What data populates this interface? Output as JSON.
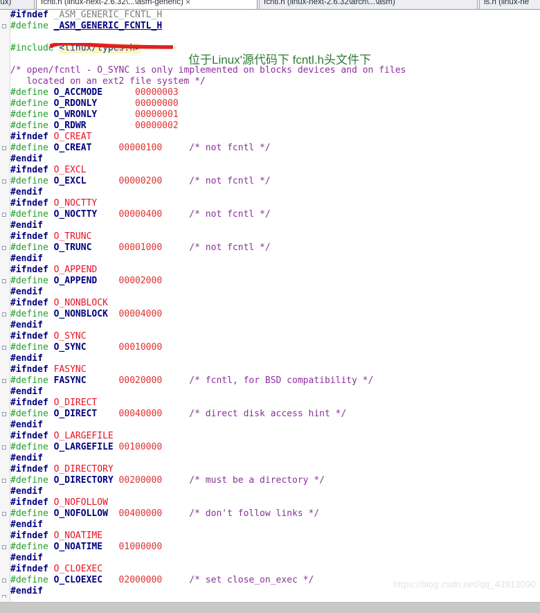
{
  "window": {
    "app": "source-code-editor",
    "tabs": [
      {
        "label": "(linux)",
        "active": false,
        "closable": false
      },
      {
        "label": "fcntl.h (linux-next-2.6.32\\...\\asm-generic)",
        "active": true,
        "closable": true
      },
      {
        "label": "fcntl.h (linux-next-2.6.32\\arch\\...\\asm)",
        "active": false,
        "closable": false
      },
      {
        "label": "ls.h (linux-ne",
        "active": false,
        "closable": false
      }
    ]
  },
  "annotations": {
    "chinese_note": "位于Linux'源代码下 fcntl.h头文件下",
    "chinese_note_color": "#2f7a34",
    "red_underline_color": "#e02020",
    "red_underline_target": "_ASM_GENERIC_FCNTL_H"
  },
  "watermark": {
    "text": "https://blog.csdn.net/qq_43913090"
  },
  "colors": {
    "preprocessor_conditional": "#000080",
    "define_keyword": "#1f9b28",
    "macro_name": "#000080",
    "ifndef_arg": "#e81123",
    "number": "#e03030",
    "comment": "#8a2f9a",
    "header_highlight_bg": "#fdf6b8",
    "header_text": "#1030c0",
    "editor_bg": "#ffffff",
    "gutter_bg": "#f6f6f6",
    "scrollbar_bg": "#c8c8c8"
  },
  "code": {
    "filename": "fcntl.h",
    "guard": "_ASM_GENERIC_FCNTL_H",
    "include": "<linux/types.h>",
    "header_comment": [
      "/* open/fcntl - O_SYNC is only implemented on blocks devices and on files",
      "   located on an ext2 file system */"
    ],
    "plain_defines": [
      {
        "name": "O_ACCMODE",
        "value": "00000003"
      },
      {
        "name": "O_RDONLY",
        "value": "00000000"
      },
      {
        "name": "O_WRONLY",
        "value": "00000001"
      },
      {
        "name": "O_RDWR",
        "value": "00000002"
      }
    ],
    "guarded_defines": [
      {
        "name": "O_CREAT",
        "value": "00000100",
        "comment": "/* not fcntl */"
      },
      {
        "name": "O_EXCL",
        "value": "00000200",
        "comment": "/* not fcntl */"
      },
      {
        "name": "O_NOCTTY",
        "value": "00000400",
        "comment": "/* not fcntl */"
      },
      {
        "name": "O_TRUNC",
        "value": "00001000",
        "comment": "/* not fcntl */"
      },
      {
        "name": "O_APPEND",
        "value": "00002000",
        "comment": ""
      },
      {
        "name": "O_NONBLOCK",
        "value": "00004000",
        "comment": ""
      },
      {
        "name": "O_SYNC",
        "value": "00010000",
        "comment": ""
      },
      {
        "name": "FASYNC",
        "value": "00020000",
        "comment": "/* fcntl, for BSD compatibility */"
      },
      {
        "name": "O_DIRECT",
        "value": "00040000",
        "comment": "/* direct disk access hint */"
      },
      {
        "name": "O_LARGEFILE",
        "value": "00100000",
        "comment": ""
      },
      {
        "name": "O_DIRECTORY",
        "value": "00200000",
        "comment": "/* must be a directory */"
      },
      {
        "name": "O_NOFOLLOW",
        "value": "00400000",
        "comment": "/* don't follow links */"
      },
      {
        "name": "O_NOATIME",
        "value": "01000000",
        "comment": ""
      },
      {
        "name": "O_CLOEXEC",
        "value": "02000000",
        "comment": "/* set close_on_exec */"
      }
    ],
    "keywords": {
      "ifndef": "#ifndef",
      "define": "#define",
      "endif": "#endif",
      "include": "#include"
    }
  }
}
